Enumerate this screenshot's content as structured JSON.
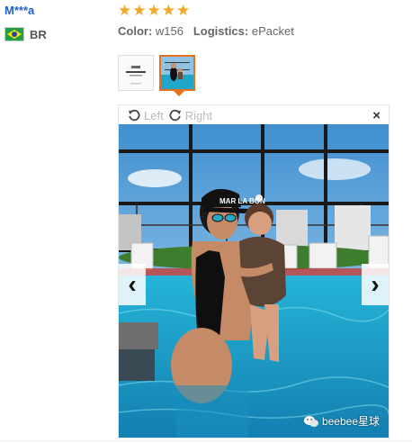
{
  "review": {
    "reviewer": "M***a",
    "country_code": "BR",
    "rating": 5,
    "color_label": "Color:",
    "color_value": "w156",
    "logistics_label": "Logistics:",
    "logistics_value": "ePacket"
  },
  "viewer": {
    "rotate_left_label": "Left",
    "rotate_right_label": "Right",
    "close_glyph": "×",
    "prev_glyph": "‹",
    "next_glyph": "›",
    "cap_text": "MAR LA BON"
  },
  "watermark": {
    "text": "beebee星球"
  },
  "colors": {
    "star": "#f5a623",
    "accent": "#e8701a",
    "link": "#2060c0",
    "pool": "#1fa6c9"
  }
}
